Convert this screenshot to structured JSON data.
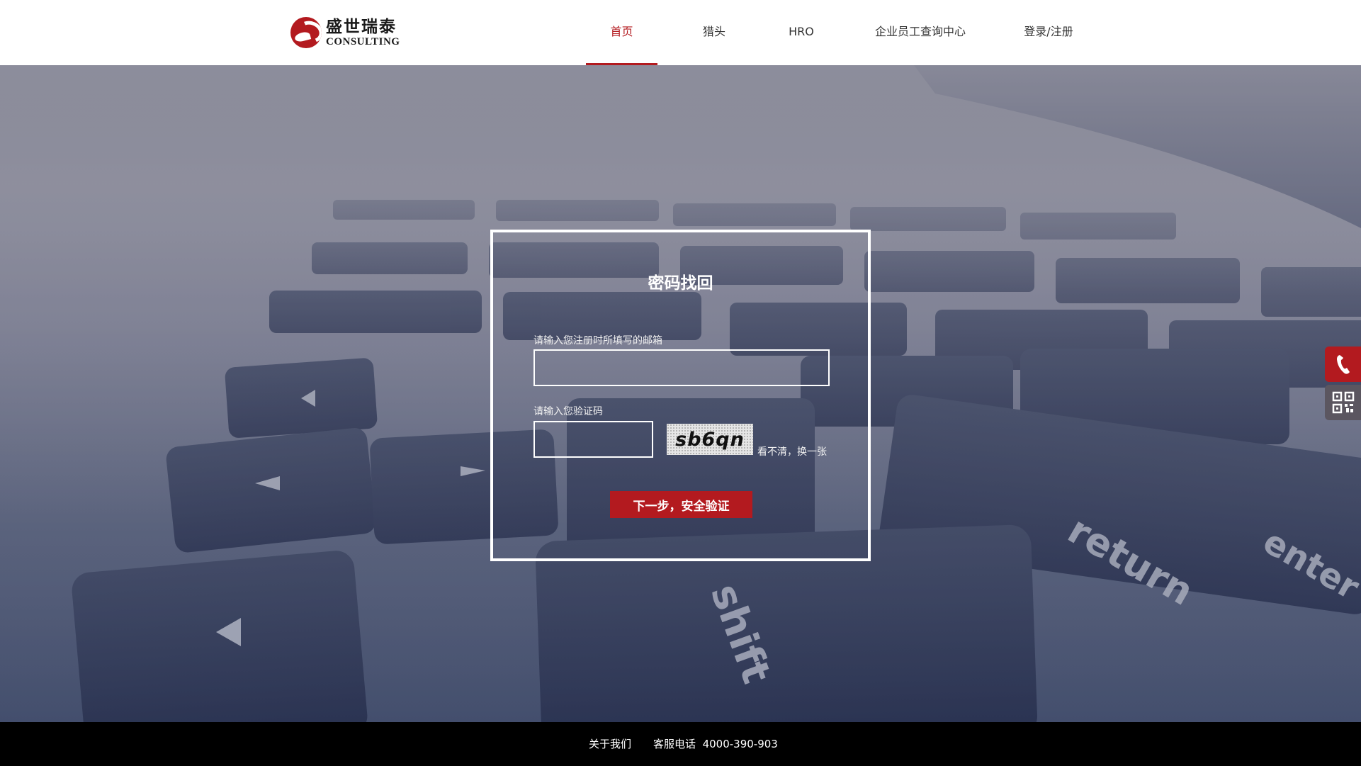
{
  "header": {
    "logo_cn": "盛世瑞泰",
    "logo_en": "CONSULTING",
    "nav": [
      {
        "label": "首页",
        "active": true
      },
      {
        "label": "猎头",
        "active": false
      },
      {
        "label": "HRO",
        "active": false
      },
      {
        "label": "企业员工查询中心",
        "active": false
      },
      {
        "label": "登录/注册",
        "active": false
      }
    ]
  },
  "form": {
    "title": "密码找回",
    "email_label": "请输入您注册时所填写的邮箱",
    "email_value": "",
    "code_label": "请输入您验证码",
    "code_value": "",
    "captcha_text": "sb6qn",
    "refresh_label": "看不清，换一张",
    "submit_label": "下一步，安全验证"
  },
  "side_buttons": [
    {
      "icon": "phone-icon"
    },
    {
      "icon": "qr-code-icon"
    }
  ],
  "footer": {
    "about_label": "关于我们",
    "phone_label": "客服电话",
    "phone_number": "4000-390-903"
  },
  "colors": {
    "accent": "#b31a1f",
    "footer_bg": "#000000"
  }
}
